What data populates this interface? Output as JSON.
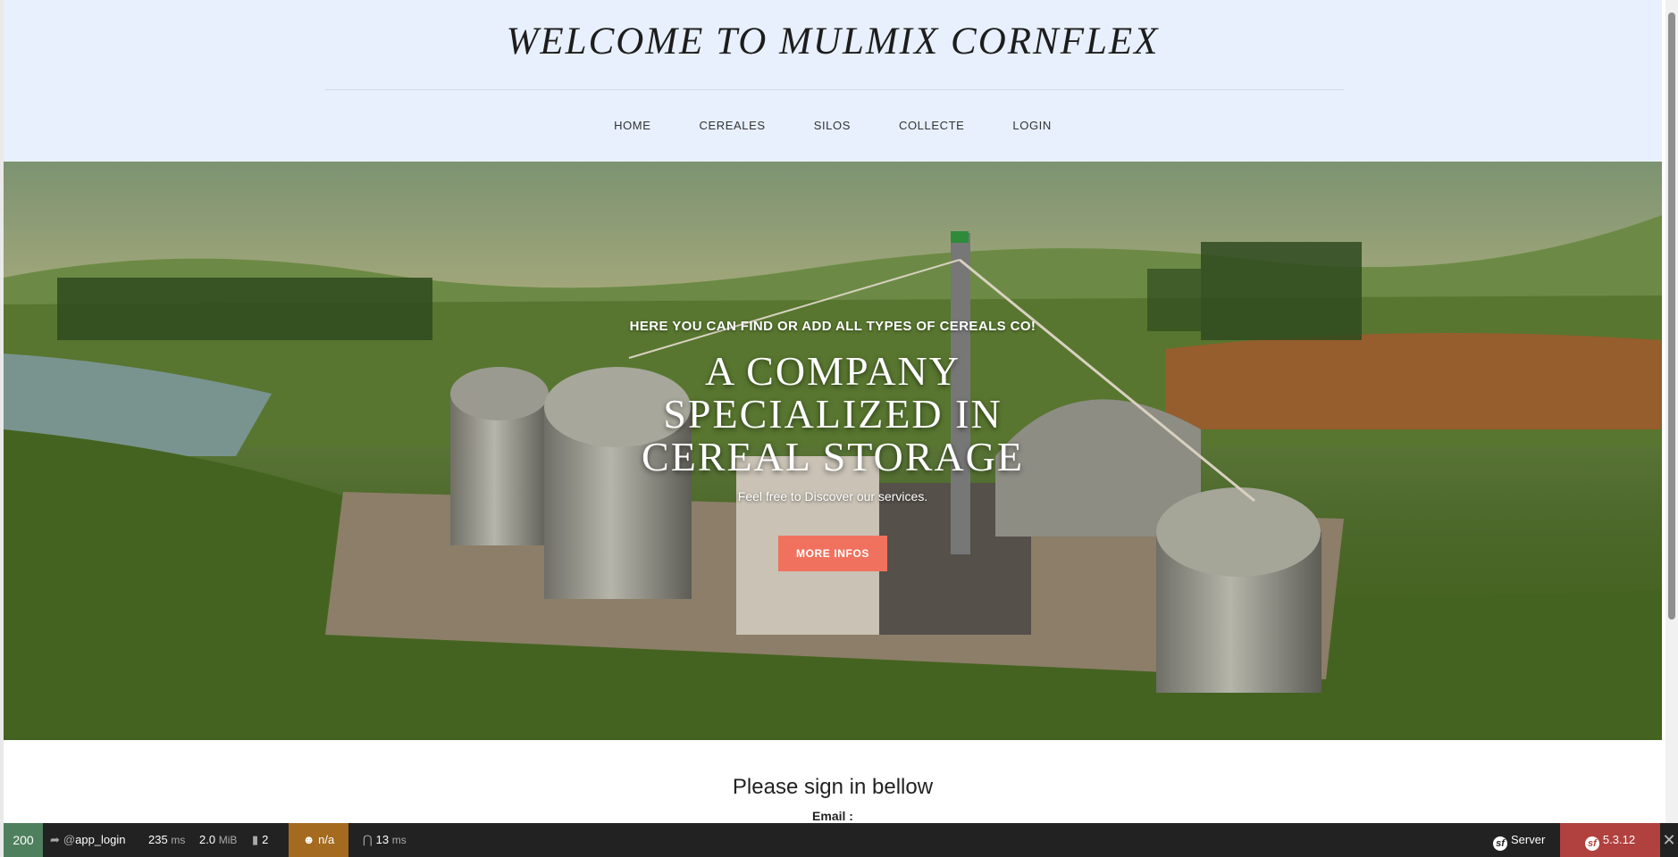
{
  "header": {
    "title": "WELCOME TO MULMIX CORNFLEX",
    "nav": [
      "HOME",
      "CEREALES",
      "SILOS",
      "COLLECTE",
      "LOGIN"
    ]
  },
  "hero": {
    "eyebrow": "HERE YOU CAN FIND OR ADD ALL TYPES OF CEREALS CO!",
    "heading": "A COMPANY SPECIALIZED IN CEREAL STORAGE",
    "subtitle": "Feel free to Discover our services.",
    "button_label": "MORE INFOS",
    "button_color": "#f0725e"
  },
  "signin": {
    "title": "Please sign in bellow",
    "email_label": "Email :"
  },
  "toolbar": {
    "status": "200",
    "route_prefix": "@",
    "route": "app_login",
    "time_value": "235",
    "time_unit": "ms",
    "memory_value": "2.0",
    "memory_unit": "MiB",
    "cache_count": "2",
    "user": "n/a",
    "twig_value": "13",
    "twig_unit": "ms",
    "server_label": "Server",
    "version": "5.3.12",
    "colors": {
      "status": "#4f805d",
      "user": "#a46a1f",
      "version": "#b0413e"
    }
  }
}
